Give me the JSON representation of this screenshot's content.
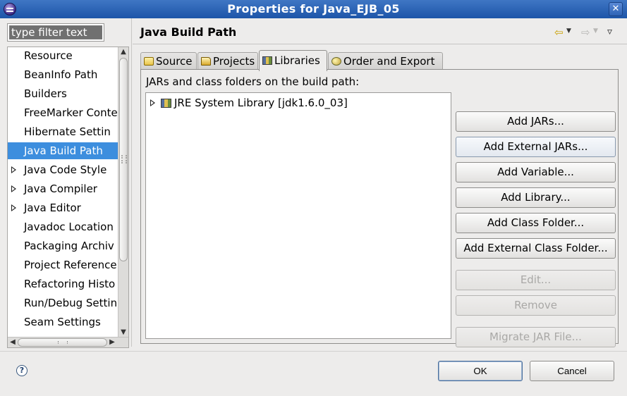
{
  "window": {
    "title": "Properties for Java_EJB_05",
    "close_glyph": "✕"
  },
  "filter": {
    "placeholder": "type filter text"
  },
  "sidebar": {
    "items": [
      {
        "label": "Resource",
        "expandable": false,
        "selected": false
      },
      {
        "label": "BeanInfo Path",
        "expandable": false,
        "selected": false
      },
      {
        "label": "Builders",
        "expandable": false,
        "selected": false
      },
      {
        "label": "FreeMarker Conte",
        "expandable": false,
        "selected": false
      },
      {
        "label": "Hibernate Settin",
        "expandable": false,
        "selected": false
      },
      {
        "label": "Java Build Path",
        "expandable": false,
        "selected": true
      },
      {
        "label": "Java Code Style",
        "expandable": true,
        "selected": false
      },
      {
        "label": "Java Compiler",
        "expandable": true,
        "selected": false
      },
      {
        "label": "Java Editor",
        "expandable": true,
        "selected": false
      },
      {
        "label": "Javadoc Location",
        "expandable": false,
        "selected": false
      },
      {
        "label": "Packaging Archiv",
        "expandable": false,
        "selected": false
      },
      {
        "label": "Project Reference",
        "expandable": false,
        "selected": false
      },
      {
        "label": "Refactoring Histo",
        "expandable": false,
        "selected": false
      },
      {
        "label": "Run/Debug Settin",
        "expandable": false,
        "selected": false
      },
      {
        "label": "Seam Settings",
        "expandable": false,
        "selected": false
      }
    ]
  },
  "main": {
    "page_title": "Java Build Path",
    "nav": {
      "back": "⇦",
      "forward": "⇨",
      "dropdown": "▼",
      "menu": "▿"
    },
    "tabs": [
      {
        "label": "Source",
        "icon": "source-folder-icon",
        "active": false
      },
      {
        "label": "Projects",
        "icon": "project-folder-icon",
        "active": false
      },
      {
        "label": "Libraries",
        "icon": "library-icon",
        "active": true
      },
      {
        "label": "Order and Export",
        "icon": "order-export-icon",
        "active": false
      }
    ],
    "classpath_label": "JARs and class folders on the build path:",
    "libraries": [
      {
        "label": "JRE System Library [jdk1.6.0_03]"
      }
    ],
    "buttons": {
      "add_jars": "Add JARs...",
      "add_external_jars": "Add External JARs...",
      "add_variable": "Add Variable...",
      "add_library": "Add Library...",
      "add_class_folder": "Add Class Folder...",
      "add_external_class_folder": "Add External Class Folder...",
      "edit": "Edit...",
      "remove": "Remove",
      "migrate_jar": "Migrate JAR File..."
    }
  },
  "footer": {
    "help_glyph": "?",
    "ok_label": "OK",
    "cancel_label": "Cancel"
  },
  "colors": {
    "titlebar": "#2a5fae",
    "selection": "#3d8ede",
    "dialog_bg": "#edeceb",
    "disabled_text": "#a9a8a6"
  }
}
